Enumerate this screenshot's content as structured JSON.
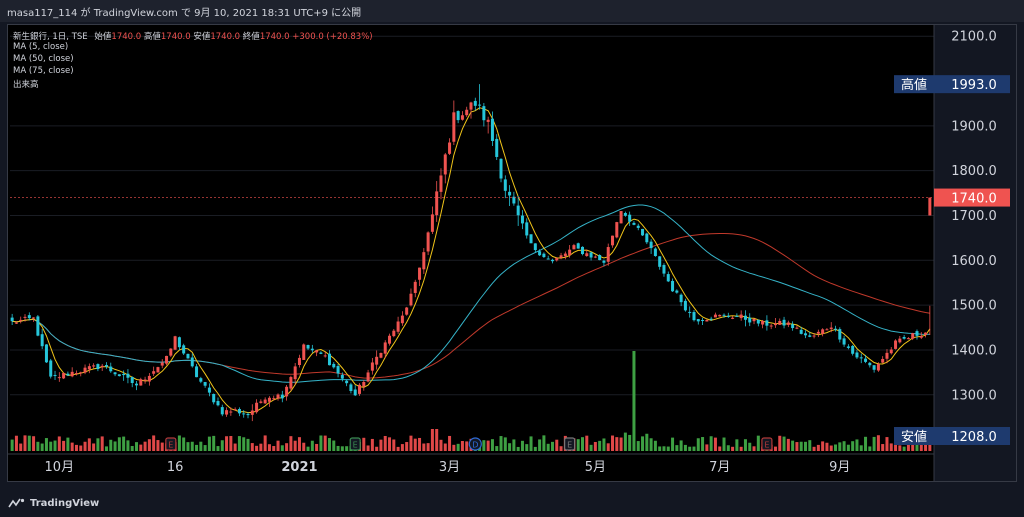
{
  "header": {
    "publish_line": "masa117_114 が TradingView.com で 9月 10, 2021 18:31 UTC+9 に公開"
  },
  "legend": {
    "symbol_line": "新生銀行, 1日, TSE",
    "ohlc_prefix": "始値",
    "open": "1740.0",
    "high_label": "高値",
    "high": "1740.0",
    "low_label": "安値",
    "low": "1740.0",
    "close_label": "終値",
    "close": "1740.0",
    "change": "+300.0 (+20.83%)",
    "ma5": "MA (5, close)",
    "ma50": "MA (50, close)",
    "ma75": "MA (75, close)",
    "volume": "出来高"
  },
  "price_tags": {
    "high_label": "高値",
    "high_value": "1993.0",
    "last_value": "1740.0",
    "low_label": "安値",
    "low_value": "1208.0"
  },
  "footer": {
    "brand": "TradingView"
  },
  "colors": {
    "up": "#ef5350",
    "down": "#26c6da",
    "ma5": "#f0c419",
    "ma50": "#35b3c8",
    "ma75": "#c0392b",
    "vol_up": "#e04848",
    "vol_down": "#3ea043",
    "tag_bg": "#1e3a6e"
  },
  "chart_data": {
    "type": "candlestick",
    "title": "新生銀行, 1日, TSE",
    "ylim": [
      1208,
      2125
    ],
    "y_ticks": [
      1300,
      1400,
      1500,
      1600,
      1700,
      1800,
      1900,
      2100
    ],
    "y_tick_labels": [
      "1300.0",
      "1400.0",
      "1500.0",
      "1600.0",
      "1700.0",
      "1800.0",
      "1900.0",
      "2100.0"
    ],
    "x_tick_labels": [
      "10月",
      "16",
      "2021",
      "3月",
      "5月",
      "7月",
      "9月"
    ],
    "x_tick_days": [
      11,
      38,
      67,
      102,
      136,
      165,
      193
    ],
    "n_days": 215,
    "last_close": 1740,
    "high": 1993,
    "low": 1208,
    "event_markers": [
      {
        "day": 37,
        "letter": "E",
        "color": "#b03838"
      },
      {
        "day": 80,
        "letter": "E",
        "color": "#3a8a50"
      },
      {
        "day": 108,
        "letter": "D",
        "color": "#2e6bd8"
      },
      {
        "day": 130,
        "letter": "E",
        "color": "#777777"
      },
      {
        "day": 176,
        "letter": "E",
        "color": "#b03838"
      }
    ],
    "anchors": [
      [
        0,
        1462
      ],
      [
        5,
        1470
      ],
      [
        9,
        1336
      ],
      [
        14,
        1350
      ],
      [
        21,
        1365
      ],
      [
        29,
        1322
      ],
      [
        36,
        1380
      ],
      [
        38,
        1427
      ],
      [
        43,
        1342
      ],
      [
        49,
        1262
      ],
      [
        52,
        1265
      ],
      [
        55,
        1256
      ],
      [
        59,
        1296
      ],
      [
        63,
        1299
      ],
      [
        68,
        1408
      ],
      [
        73,
        1385
      ],
      [
        80,
        1299
      ],
      [
        86,
        1400
      ],
      [
        91,
        1474
      ],
      [
        94,
        1545
      ],
      [
        98,
        1700
      ],
      [
        103,
        1918
      ],
      [
        108,
        1950
      ],
      [
        111,
        1905
      ],
      [
        115,
        1760
      ],
      [
        121,
        1633
      ],
      [
        126,
        1596
      ],
      [
        131,
        1628
      ],
      [
        138,
        1597
      ],
      [
        142,
        1717
      ],
      [
        148,
        1640
      ],
      [
        154,
        1536
      ],
      [
        159,
        1468
      ],
      [
        164,
        1475
      ],
      [
        169,
        1476
      ],
      [
        175,
        1458
      ],
      [
        181,
        1458
      ],
      [
        186,
        1426
      ],
      [
        191,
        1455
      ],
      [
        196,
        1392
      ],
      [
        201,
        1358
      ],
      [
        206,
        1415
      ],
      [
        210,
        1432
      ],
      [
        213,
        1440
      ],
      [
        214,
        1497
      ]
    ],
    "series": [
      {
        "name": "MA (5, close)"
      },
      {
        "name": "MA (50, close)"
      },
      {
        "name": "MA (75, close)"
      },
      {
        "name": "出来高"
      }
    ]
  }
}
